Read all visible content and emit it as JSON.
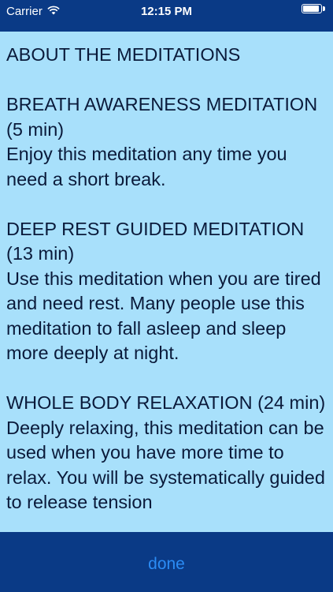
{
  "status_bar": {
    "carrier": "Carrier",
    "time": "12:15 PM",
    "wifi_icon": "wifi-icon",
    "battery_icon": "battery-icon"
  },
  "content": {
    "heading": "ABOUT THE MEDITATIONS",
    "sections": [
      {
        "title": "BREATH AWARENESS MEDITATION (5 min)",
        "body": "Enjoy this meditation any time you need a short break."
      },
      {
        "title": "DEEP REST GUIDED MEDITATION (13 min)",
        "body": "Use this meditation when you are tired and need rest. Many people use this meditation to fall asleep and sleep more deeply at night."
      },
      {
        "title": "WHOLE BODY RELAXATION (24 min)",
        "body": "Deeply relaxing, this meditation can be used when you have more time to relax. You will be systematically guided to release tension"
      }
    ]
  },
  "toolbar": {
    "done_label": "done"
  },
  "colors": {
    "bar_background": "#0a3a86",
    "content_background": "#a8e0fb",
    "text": "#0a1a3a",
    "done_button": "#2b8cf5"
  }
}
